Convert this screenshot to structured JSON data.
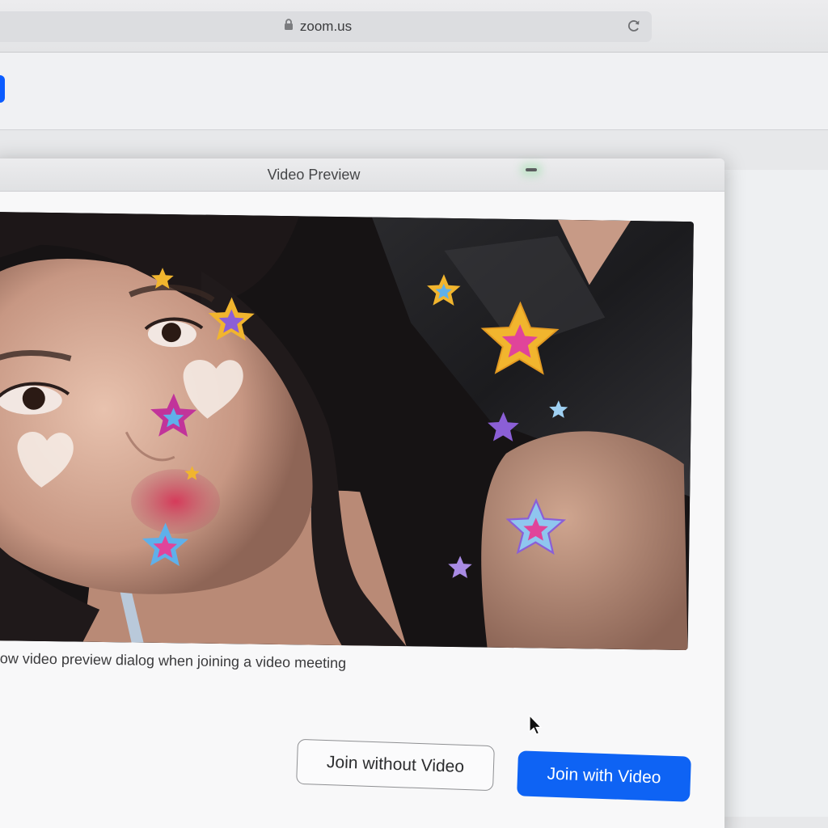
{
  "browser": {
    "address": "zoom.us",
    "lock_icon": "lock-icon",
    "reload_icon": "reload-icon"
  },
  "dialog": {
    "title": "Video Preview",
    "minimize_icon": "minimize-icon",
    "show_preview_label": "how video preview dialog when joining a video meeting",
    "join_without_video_label": "Join without Video",
    "join_with_video_label": "Join with Video"
  },
  "colors": {
    "accent_blue": "#0e63f4",
    "zoom_brand": "#0b5cff",
    "star_gold": "#f1b52e",
    "star_pink": "#e0449a",
    "star_blue": "#5fb0ea",
    "star_purple": "#8b5fd6"
  }
}
